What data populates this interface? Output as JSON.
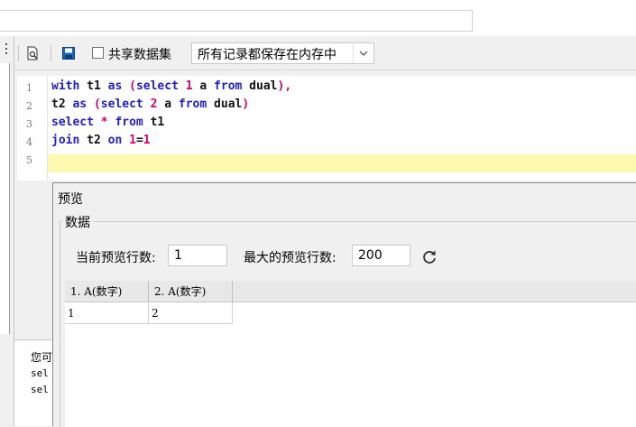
{
  "toolbar": {
    "share_dataset_label": "共享数据集",
    "storage_mode_value": "所有记录都保存在内存中"
  },
  "editor": {
    "line_numbers": [
      "1",
      "2",
      "3",
      "4",
      "5"
    ],
    "lines": [
      [
        {
          "t": "with",
          "c": "kw"
        },
        {
          "t": " t1 ",
          "c": "plain"
        },
        {
          "t": "as",
          "c": "kw"
        },
        {
          "t": " ",
          "c": "plain"
        },
        {
          "t": "(",
          "c": "par"
        },
        {
          "t": "select",
          "c": "kw"
        },
        {
          "t": " ",
          "c": "plain"
        },
        {
          "t": "1",
          "c": "num"
        },
        {
          "t": " a ",
          "c": "plain"
        },
        {
          "t": "from",
          "c": "kw"
        },
        {
          "t": " dual",
          "c": "plain"
        },
        {
          "t": "),",
          "c": "par"
        }
      ],
      [
        {
          "t": "t2 ",
          "c": "plain"
        },
        {
          "t": "as",
          "c": "kw"
        },
        {
          "t": " ",
          "c": "plain"
        },
        {
          "t": "(",
          "c": "par"
        },
        {
          "t": "select",
          "c": "kw"
        },
        {
          "t": " ",
          "c": "plain"
        },
        {
          "t": "2",
          "c": "num"
        },
        {
          "t": " a ",
          "c": "plain"
        },
        {
          "t": "from",
          "c": "kw"
        },
        {
          "t": " dual",
          "c": "plain"
        },
        {
          "t": ")",
          "c": "par"
        }
      ],
      [
        {
          "t": "select",
          "c": "kw"
        },
        {
          "t": " ",
          "c": "plain"
        },
        {
          "t": "*",
          "c": "num"
        },
        {
          "t": " ",
          "c": "plain"
        },
        {
          "t": "from",
          "c": "kw"
        },
        {
          "t": " t1",
          "c": "plain"
        }
      ],
      [
        {
          "t": "join",
          "c": "kw"
        },
        {
          "t": " t2 ",
          "c": "plain"
        },
        {
          "t": "on",
          "c": "kw"
        },
        {
          "t": " ",
          "c": "plain"
        },
        {
          "t": "1",
          "c": "num"
        },
        {
          "t": "=",
          "c": "plain"
        },
        {
          "t": "1",
          "c": "num"
        }
      ],
      []
    ]
  },
  "log": {
    "line1": "您可",
    "line2": "sel",
    "line3": "sel"
  },
  "preview": {
    "title": "预览",
    "group_label": "数据",
    "current_rows_label": "当前预览行数:",
    "current_rows_value": "1",
    "max_rows_label": "最大的预览行数:",
    "max_rows_value": "200",
    "columns": [
      "1. A(数字)",
      "2. A(数字)"
    ],
    "rows": [
      [
        "1",
        "2"
      ]
    ]
  },
  "colors": {
    "keyword": "#1e1ec8",
    "literal": "#d4006a",
    "current_line": "#fdfab0"
  },
  "icons": [
    "preview-file-icon",
    "save-icon",
    "refresh-icon",
    "chevron-down-icon"
  ]
}
